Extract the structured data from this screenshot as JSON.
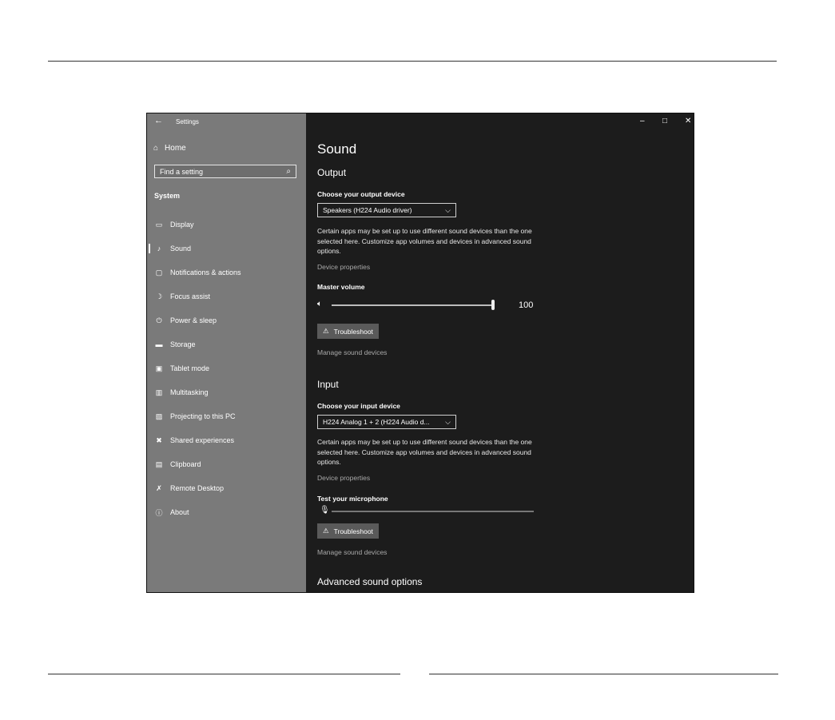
{
  "window": {
    "title": "Settings",
    "back_icon": "←",
    "controls": {
      "minimize": "–",
      "maximize": "□",
      "close": "✕"
    }
  },
  "sidebar": {
    "home": {
      "icon": "⌂",
      "label": "Home"
    },
    "search_placeholder": "Find a setting",
    "search_icon": "⌕",
    "section": "System",
    "items": [
      {
        "label": "Display",
        "icon": "▭"
      },
      {
        "label": "Sound",
        "icon": "♪"
      },
      {
        "label": "Notifications & actions",
        "icon": "▢"
      },
      {
        "label": "Focus assist",
        "icon": "☽"
      },
      {
        "label": "Power & sleep",
        "icon": "⏻"
      },
      {
        "label": "Storage",
        "icon": "▬"
      },
      {
        "label": "Tablet mode",
        "icon": "▣"
      },
      {
        "label": "Multitasking",
        "icon": "▥"
      },
      {
        "label": "Projecting to this PC",
        "icon": "▨"
      },
      {
        "label": "Shared experiences",
        "icon": "✖"
      },
      {
        "label": "Clipboard",
        "icon": "▤"
      },
      {
        "label": "Remote Desktop",
        "icon": "✗"
      },
      {
        "label": "About",
        "icon": "ⓘ"
      }
    ],
    "selected_index": 1
  },
  "main": {
    "title": "Sound",
    "output": {
      "heading": "Output",
      "device_label": "Choose your output device",
      "device_value": "Speakers (H224 Audio driver)",
      "description": "Certain apps may be set up to use different sound devices than the one selected here. Customize app volumes and devices in advanced sound options.",
      "device_properties": "Device properties",
      "master_volume_label": "Master volume",
      "master_volume_value": "100",
      "volume_level": 1.0,
      "troubleshoot": "Troubleshoot",
      "manage": "Manage sound devices"
    },
    "input": {
      "heading": "Input",
      "device_label": "Choose your input device",
      "device_value": "H224 Analog 1 + 2 (H224 Audio d...",
      "description": "Certain apps may be set up to use different sound devices than the one selected here. Customize app volumes and devices in advanced sound options.",
      "device_properties": "Device properties",
      "test_label": "Test your microphone",
      "troubleshoot": "Troubleshoot",
      "manage": "Manage sound devices"
    },
    "advanced": "Advanced sound options",
    "chevron": "⌵",
    "warning_icon": "⚠",
    "speaker_icon": "🔈︎",
    "mic_icon": "🎙︎"
  }
}
